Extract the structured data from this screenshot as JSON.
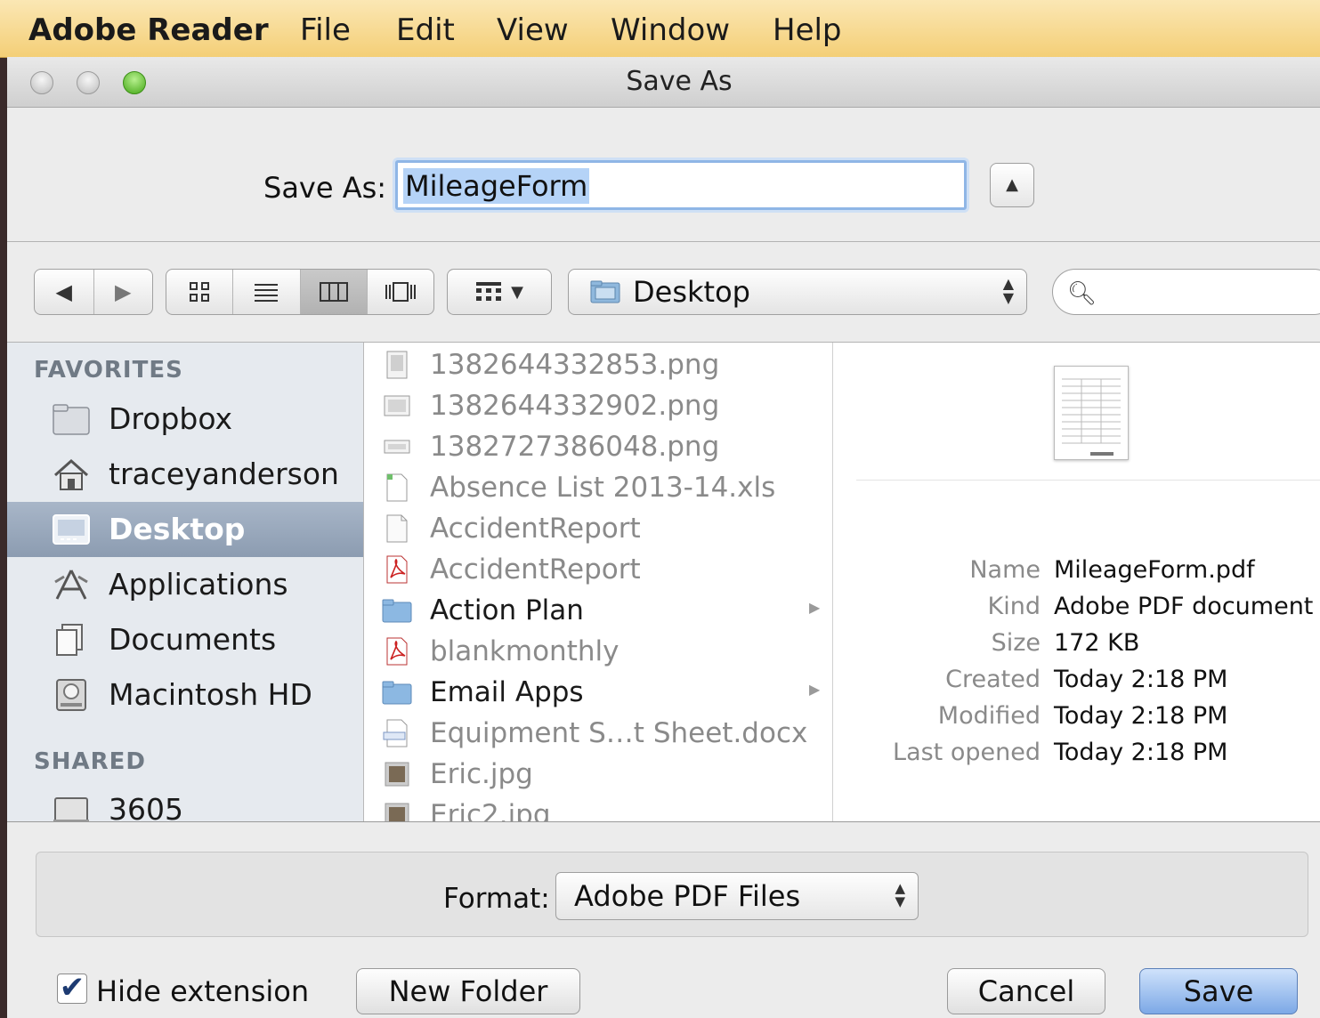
{
  "menubar": {
    "app": "Adobe Reader",
    "items": [
      "File",
      "Edit",
      "View",
      "Window",
      "Help"
    ]
  },
  "dialog": {
    "title": "Save As",
    "save_as_label": "Save As:",
    "filename_value": "MileageForm"
  },
  "toolbar": {
    "location": "Desktop",
    "search_placeholder": ""
  },
  "sidebar": {
    "favorites_heading": "FAVORITES",
    "favorites": [
      {
        "label": "Dropbox",
        "icon": "folder-icon"
      },
      {
        "label": "traceyanderson",
        "icon": "home-icon"
      },
      {
        "label": "Desktop",
        "icon": "desktop-icon",
        "selected": true
      },
      {
        "label": "Applications",
        "icon": "applications-icon"
      },
      {
        "label": "Documents",
        "icon": "documents-icon"
      },
      {
        "label": "Macintosh HD",
        "icon": "hard-drive-icon"
      }
    ],
    "shared_heading": "SHARED",
    "shared": [
      {
        "label": "3605",
        "icon": "computer-icon"
      }
    ]
  },
  "files": [
    {
      "name": "1382644332853.png",
      "kind": "image"
    },
    {
      "name": "1382644332902.png",
      "kind": "image"
    },
    {
      "name": "1382727386048.png",
      "kind": "image"
    },
    {
      "name": "Absence List 2013-14.xls",
      "kind": "spreadsheet"
    },
    {
      "name": "AccidentReport",
      "kind": "document"
    },
    {
      "name": "AccidentReport",
      "kind": "pdf"
    },
    {
      "name": "Action Plan",
      "kind": "folder"
    },
    {
      "name": "blankmonthly",
      "kind": "pdf"
    },
    {
      "name": "Email Apps",
      "kind": "folder"
    },
    {
      "name": "Equipment S…t Sheet.docx",
      "kind": "docx"
    },
    {
      "name": "Eric.jpg",
      "kind": "photo"
    },
    {
      "name": "Eric2.jpg",
      "kind": "photo"
    }
  ],
  "preview": {
    "meta": [
      {
        "key": "Name",
        "value": "MileageForm.pdf"
      },
      {
        "key": "Kind",
        "value": "Adobe PDF document"
      },
      {
        "key": "Size",
        "value": "172 KB"
      },
      {
        "key": "Created",
        "value": "Today 2:18 PM"
      },
      {
        "key": "Modified",
        "value": "Today 2:18 PM"
      },
      {
        "key": "Last opened",
        "value": "Today 2:18 PM"
      }
    ]
  },
  "format": {
    "label": "Format:",
    "value": "Adobe PDF Files"
  },
  "footer": {
    "hide_extension_label": "Hide extension",
    "hide_extension_checked": true,
    "new_folder": "New Folder",
    "cancel": "Cancel",
    "save": "Save"
  },
  "colors": {
    "menubar": "#f4cf77",
    "selection": "#8c9cb1",
    "default_button": "#7ca8e6"
  }
}
